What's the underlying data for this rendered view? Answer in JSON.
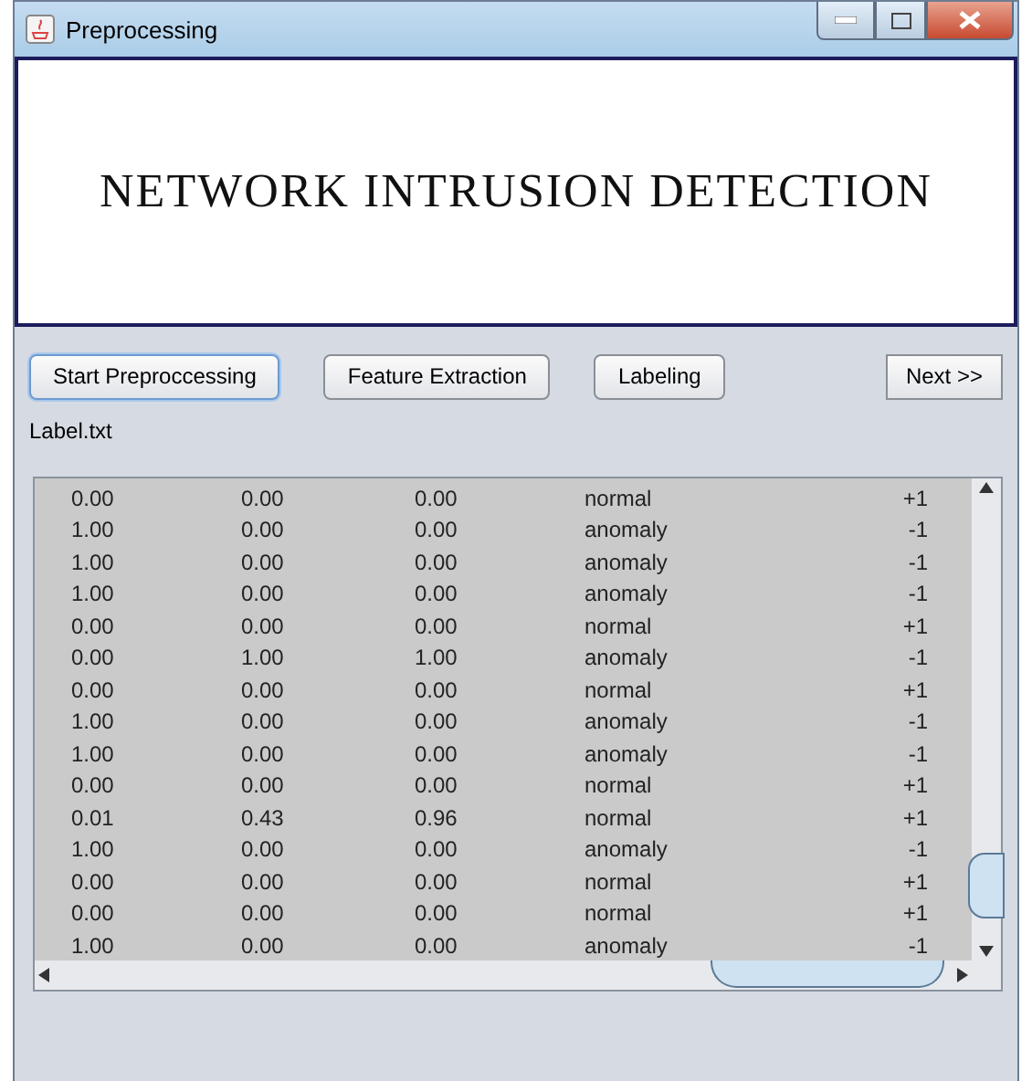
{
  "window": {
    "title": "Preprocessing"
  },
  "banner": {
    "title": "NETWORK INTRUSION DETECTION"
  },
  "buttons": [
    {
      "label": "Start Preproccessing",
      "focused": true
    },
    {
      "label": "Feature Extraction",
      "focused": false
    },
    {
      "label": "Labeling",
      "focused": false
    },
    {
      "label": "Next >>",
      "focused": false
    }
  ],
  "file_label": "Label.txt",
  "rows": [
    [
      "0.00",
      "0.00",
      "0.00",
      "normal",
      "+1"
    ],
    [
      "1.00",
      "0.00",
      "0.00",
      "anomaly",
      "-1"
    ],
    [
      "1.00",
      "0.00",
      "0.00",
      "anomaly",
      "-1"
    ],
    [
      "1.00",
      "0.00",
      "0.00",
      "anomaly",
      "-1"
    ],
    [
      "0.00",
      "0.00",
      "0.00",
      "normal",
      "+1"
    ],
    [
      "0.00",
      "1.00",
      "1.00",
      "anomaly",
      "-1"
    ],
    [
      "0.00",
      "0.00",
      "0.00",
      "normal",
      "+1"
    ],
    [
      "1.00",
      "0.00",
      "0.00",
      "anomaly",
      "-1"
    ],
    [
      "1.00",
      "0.00",
      "0.00",
      "anomaly",
      "-1"
    ],
    [
      "0.00",
      "0.00",
      "0.00",
      "normal",
      "+1"
    ],
    [
      "0.01",
      "0.43",
      "0.96",
      "normal",
      "+1"
    ],
    [
      "1.00",
      "0.00",
      "0.00",
      "anomaly",
      "-1"
    ],
    [
      "0.00",
      "0.00",
      "0.00",
      "normal",
      "+1"
    ],
    [
      "0.00",
      "0.00",
      "0.00",
      "normal",
      "+1"
    ],
    [
      "1.00",
      "0.00",
      "0.00",
      "anomaly",
      "-1"
    ]
  ]
}
